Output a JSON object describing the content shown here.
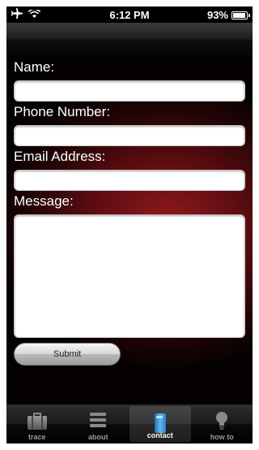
{
  "status_bar": {
    "time": "6:12 PM",
    "battery": "93%",
    "battery_level": 0.93
  },
  "form": {
    "name_label": "Name:",
    "phone_label": "Phone Number:",
    "email_label": "Email Address:",
    "message_label": "Message:",
    "name_value": "",
    "phone_value": "",
    "email_value": "",
    "message_value": "",
    "submit_label": "Submit"
  },
  "tabs": [
    {
      "label": "trace",
      "icon": "briefcase-icon"
    },
    {
      "label": "about",
      "icon": "list-icon"
    },
    {
      "label": "contact",
      "icon": "phone-icon",
      "selected": true
    },
    {
      "label": "how to",
      "icon": "lightbulb-icon"
    }
  ],
  "colors": {
    "accent": "#8f1a1e",
    "selected_icon": "#4aa3e0"
  }
}
